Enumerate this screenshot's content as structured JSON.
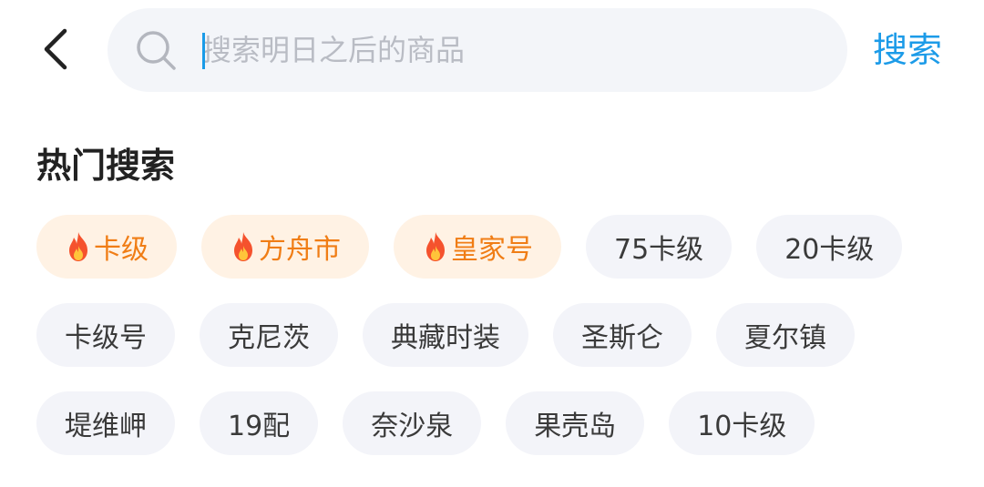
{
  "header": {
    "back_icon": "chevron-left-icon",
    "search": {
      "icon": "search-icon",
      "placeholder": "搜索明日之后的商品",
      "value": ""
    },
    "submit_label": "搜索"
  },
  "hot_search": {
    "title": "热门搜索",
    "hot_icon": "fire-icon",
    "hot_color": "#f07d15",
    "rows": [
      [
        {
          "label": "卡级",
          "hot": true
        },
        {
          "label": "方舟市",
          "hot": true
        },
        {
          "label": "皇家号",
          "hot": true
        },
        {
          "label": "75卡级",
          "hot": false
        },
        {
          "label": "20卡级",
          "hot": false
        }
      ],
      [
        {
          "label": "卡级号",
          "hot": false
        },
        {
          "label": "克尼茨",
          "hot": false
        },
        {
          "label": "典藏时装",
          "hot": false
        },
        {
          "label": "圣斯仑",
          "hot": false
        },
        {
          "label": "夏尔镇",
          "hot": false
        }
      ],
      [
        {
          "label": "堤维岬",
          "hot": false
        },
        {
          "label": "19配",
          "hot": false
        },
        {
          "label": "奈沙泉",
          "hot": false
        },
        {
          "label": "果壳岛",
          "hot": false
        },
        {
          "label": "10卡级",
          "hot": false
        }
      ]
    ]
  },
  "colors": {
    "accent": "#1c9be8",
    "tag_bg": "#f3f4f9",
    "hot_tag_bg": "#fff2e4"
  }
}
